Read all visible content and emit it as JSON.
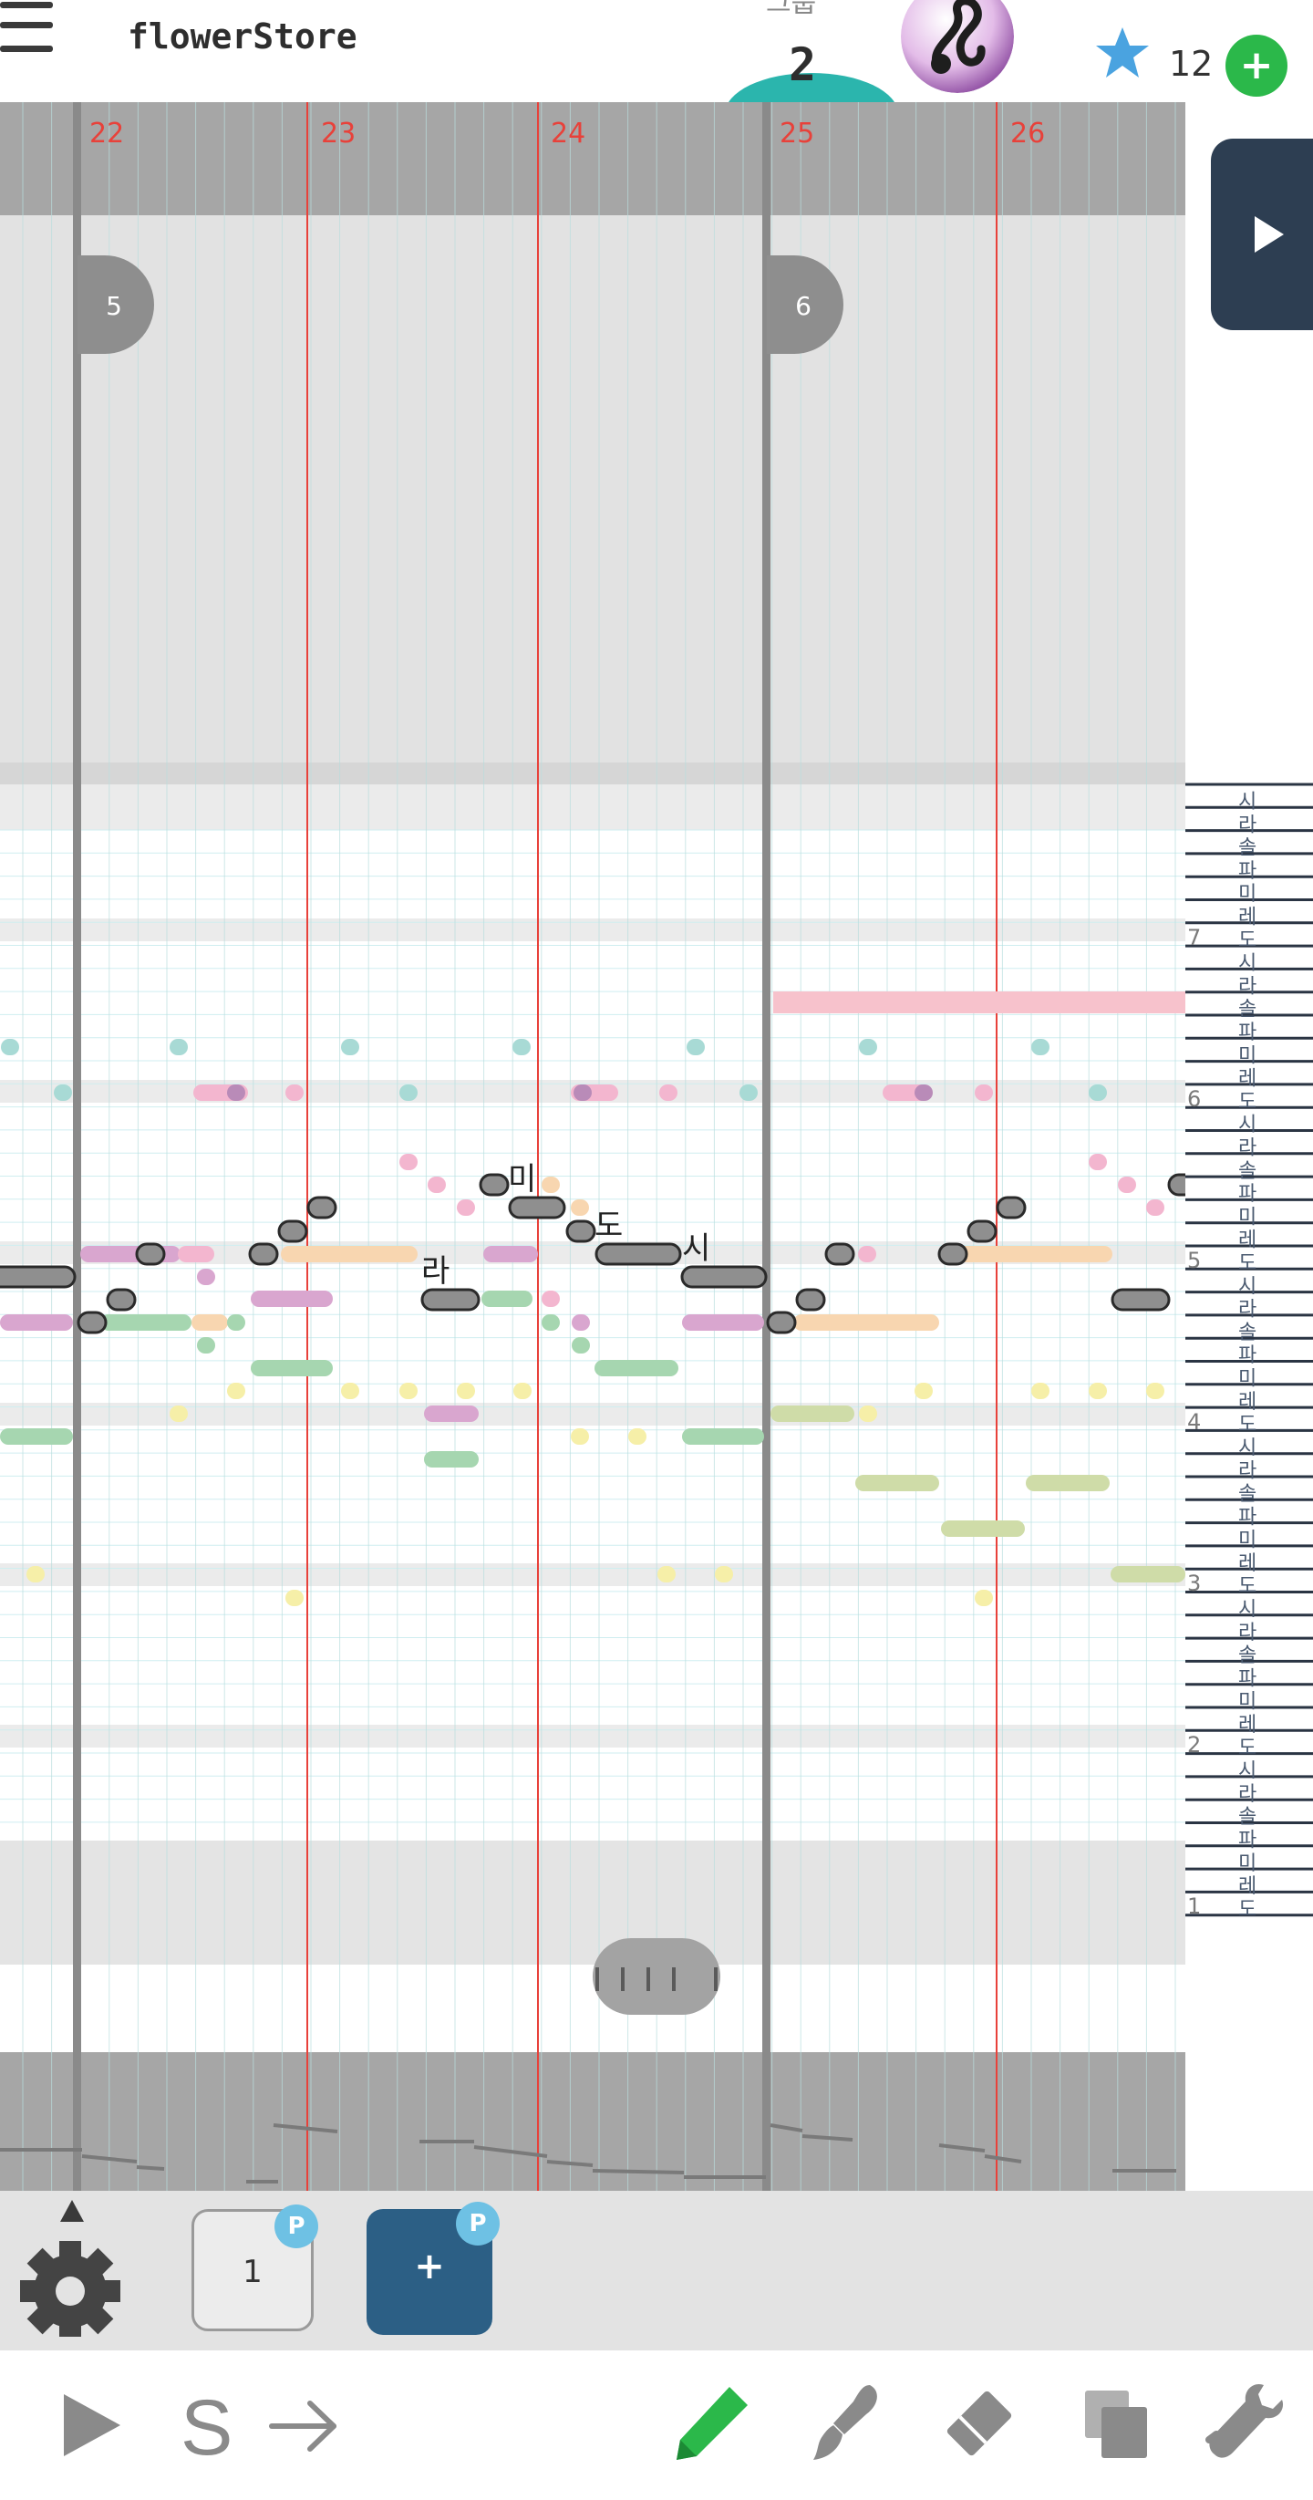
{
  "app": {
    "title": "flowerStore"
  },
  "header": {
    "page_label_partial": "그룹",
    "page_number": "2",
    "stars": "12",
    "add_star_symbol": "+"
  },
  "score": {
    "measures": [
      "22",
      "23",
      "24",
      "25",
      "26"
    ],
    "sections": [
      "5",
      "6"
    ],
    "lyrics": [
      "미",
      "도",
      "라",
      "시"
    ],
    "octaves": [
      "7",
      "6",
      "5",
      "4",
      "3",
      "2",
      "1"
    ],
    "keys": [
      "시",
      "라",
      "솔",
      "파",
      "미",
      "레",
      "도"
    ]
  },
  "pages": {
    "page1_label": "1",
    "premium_badge": "P",
    "add_symbol": "+"
  },
  "icons": {
    "menu": "menu-icon",
    "star": "star-icon",
    "play": "play-icon",
    "settings": "gear-icon",
    "solo": "s-icon",
    "next": "arrow-right-icon",
    "pencil": "pencil-icon",
    "brush": "brush-icon",
    "eraser": "eraser-icon",
    "copy": "copy-icon",
    "tools": "wrench-icon"
  },
  "colors": {
    "accent": "#2bb5ad",
    "measure_line": "#e8413a",
    "dark": "#2d3e52",
    "pencil_active": "#2bb84a",
    "page_button": "#2c5f85"
  }
}
